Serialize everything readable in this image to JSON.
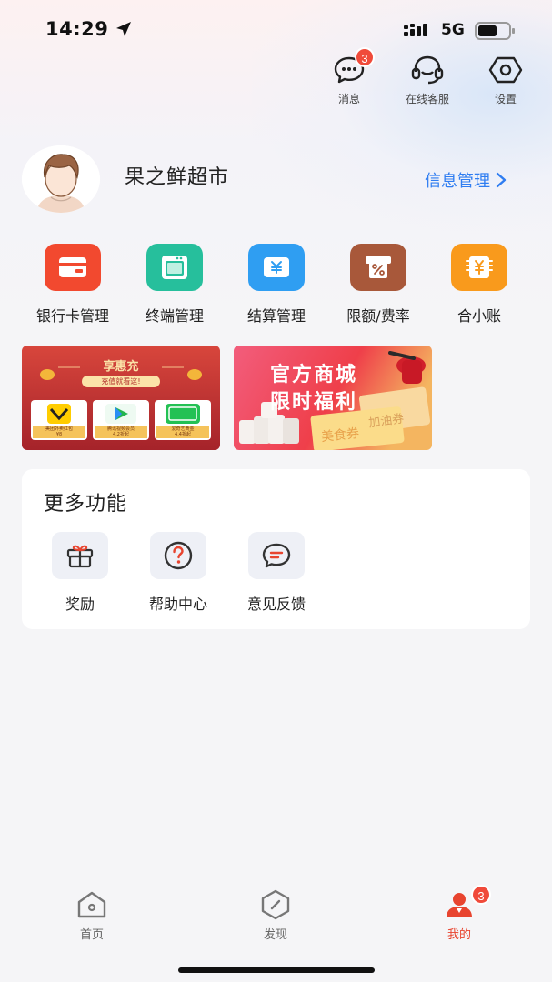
{
  "status_bar": {
    "time": "14:29",
    "network": "5G"
  },
  "top_actions": [
    {
      "label": "消息",
      "icon": "message-icon",
      "badge": "3"
    },
    {
      "label": "在线客服",
      "icon": "headset-icon"
    },
    {
      "label": "设置",
      "icon": "settings-hexagon-icon"
    }
  ],
  "profile": {
    "shop_name": "果之鲜超市",
    "info_link": "信息管理"
  },
  "services": [
    {
      "label": "银行卡管理",
      "icon": "bank-card-icon",
      "color": "#f2492f"
    },
    {
      "label": "终端管理",
      "icon": "terminal-icon",
      "color": "#26bf9c"
    },
    {
      "label": "结算管理",
      "icon": "settlement-icon",
      "color": "#2f9ef2"
    },
    {
      "label": "限额/费率",
      "icon": "rate-limit-icon",
      "color": "#a8583a"
    },
    {
      "label": "合小账",
      "icon": "ledger-icon",
      "color": "#f99a1c"
    }
  ],
  "banners": {
    "left": {
      "title": "享惠充",
      "subtitle": "充值就看这!",
      "cards": [
        {
          "name": "美团外卖红包",
          "price": "¥8"
        },
        {
          "name": "腾讯视频会员",
          "price": "4.2折起"
        },
        {
          "name": "爱奇艺黄金",
          "price": "4.4折起"
        }
      ]
    },
    "right": {
      "line1": "官方商城",
      "line2": "限时福利",
      "coupon1": "加油券",
      "coupon2": "美食券"
    }
  },
  "more": {
    "title": "更多功能",
    "items": [
      {
        "label": "奖励",
        "icon": "gift-icon"
      },
      {
        "label": "帮助中心",
        "icon": "help-icon"
      },
      {
        "label": "意见反馈",
        "icon": "feedback-icon"
      }
    ]
  },
  "tabbar": {
    "tabs": [
      {
        "label": "首页",
        "icon": "home-icon",
        "active": false
      },
      {
        "label": "发现",
        "icon": "discover-icon",
        "active": false
      },
      {
        "label": "我的",
        "icon": "profile-icon",
        "active": true,
        "badge": "3"
      }
    ]
  },
  "colors": {
    "accent_red": "#e8442f",
    "link_blue": "#2f7df1",
    "badge_red": "#f04a3a"
  }
}
